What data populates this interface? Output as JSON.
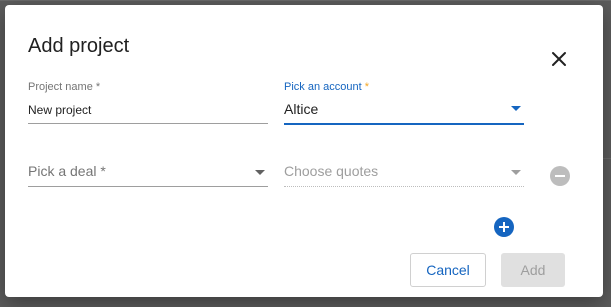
{
  "dialog": {
    "title": "Add project",
    "close_icon": "close-icon"
  },
  "fields": {
    "project_name": {
      "label": "Project name",
      "required_mark": "*",
      "value": "New project"
    },
    "account": {
      "label": "Pick an account",
      "required_mark": "*",
      "value": "Altice"
    },
    "deal": {
      "placeholder": "Pick a deal *"
    },
    "quotes": {
      "placeholder": "Choose quotes"
    }
  },
  "icons": {
    "remove": "remove-circle-icon",
    "add": "add-circle-icon"
  },
  "buttons": {
    "cancel_label": "Cancel",
    "add_label": "Add"
  },
  "colors": {
    "accent": "#1565c0",
    "required_focused": "#f5a623",
    "disabled": "#e0e0e0"
  }
}
